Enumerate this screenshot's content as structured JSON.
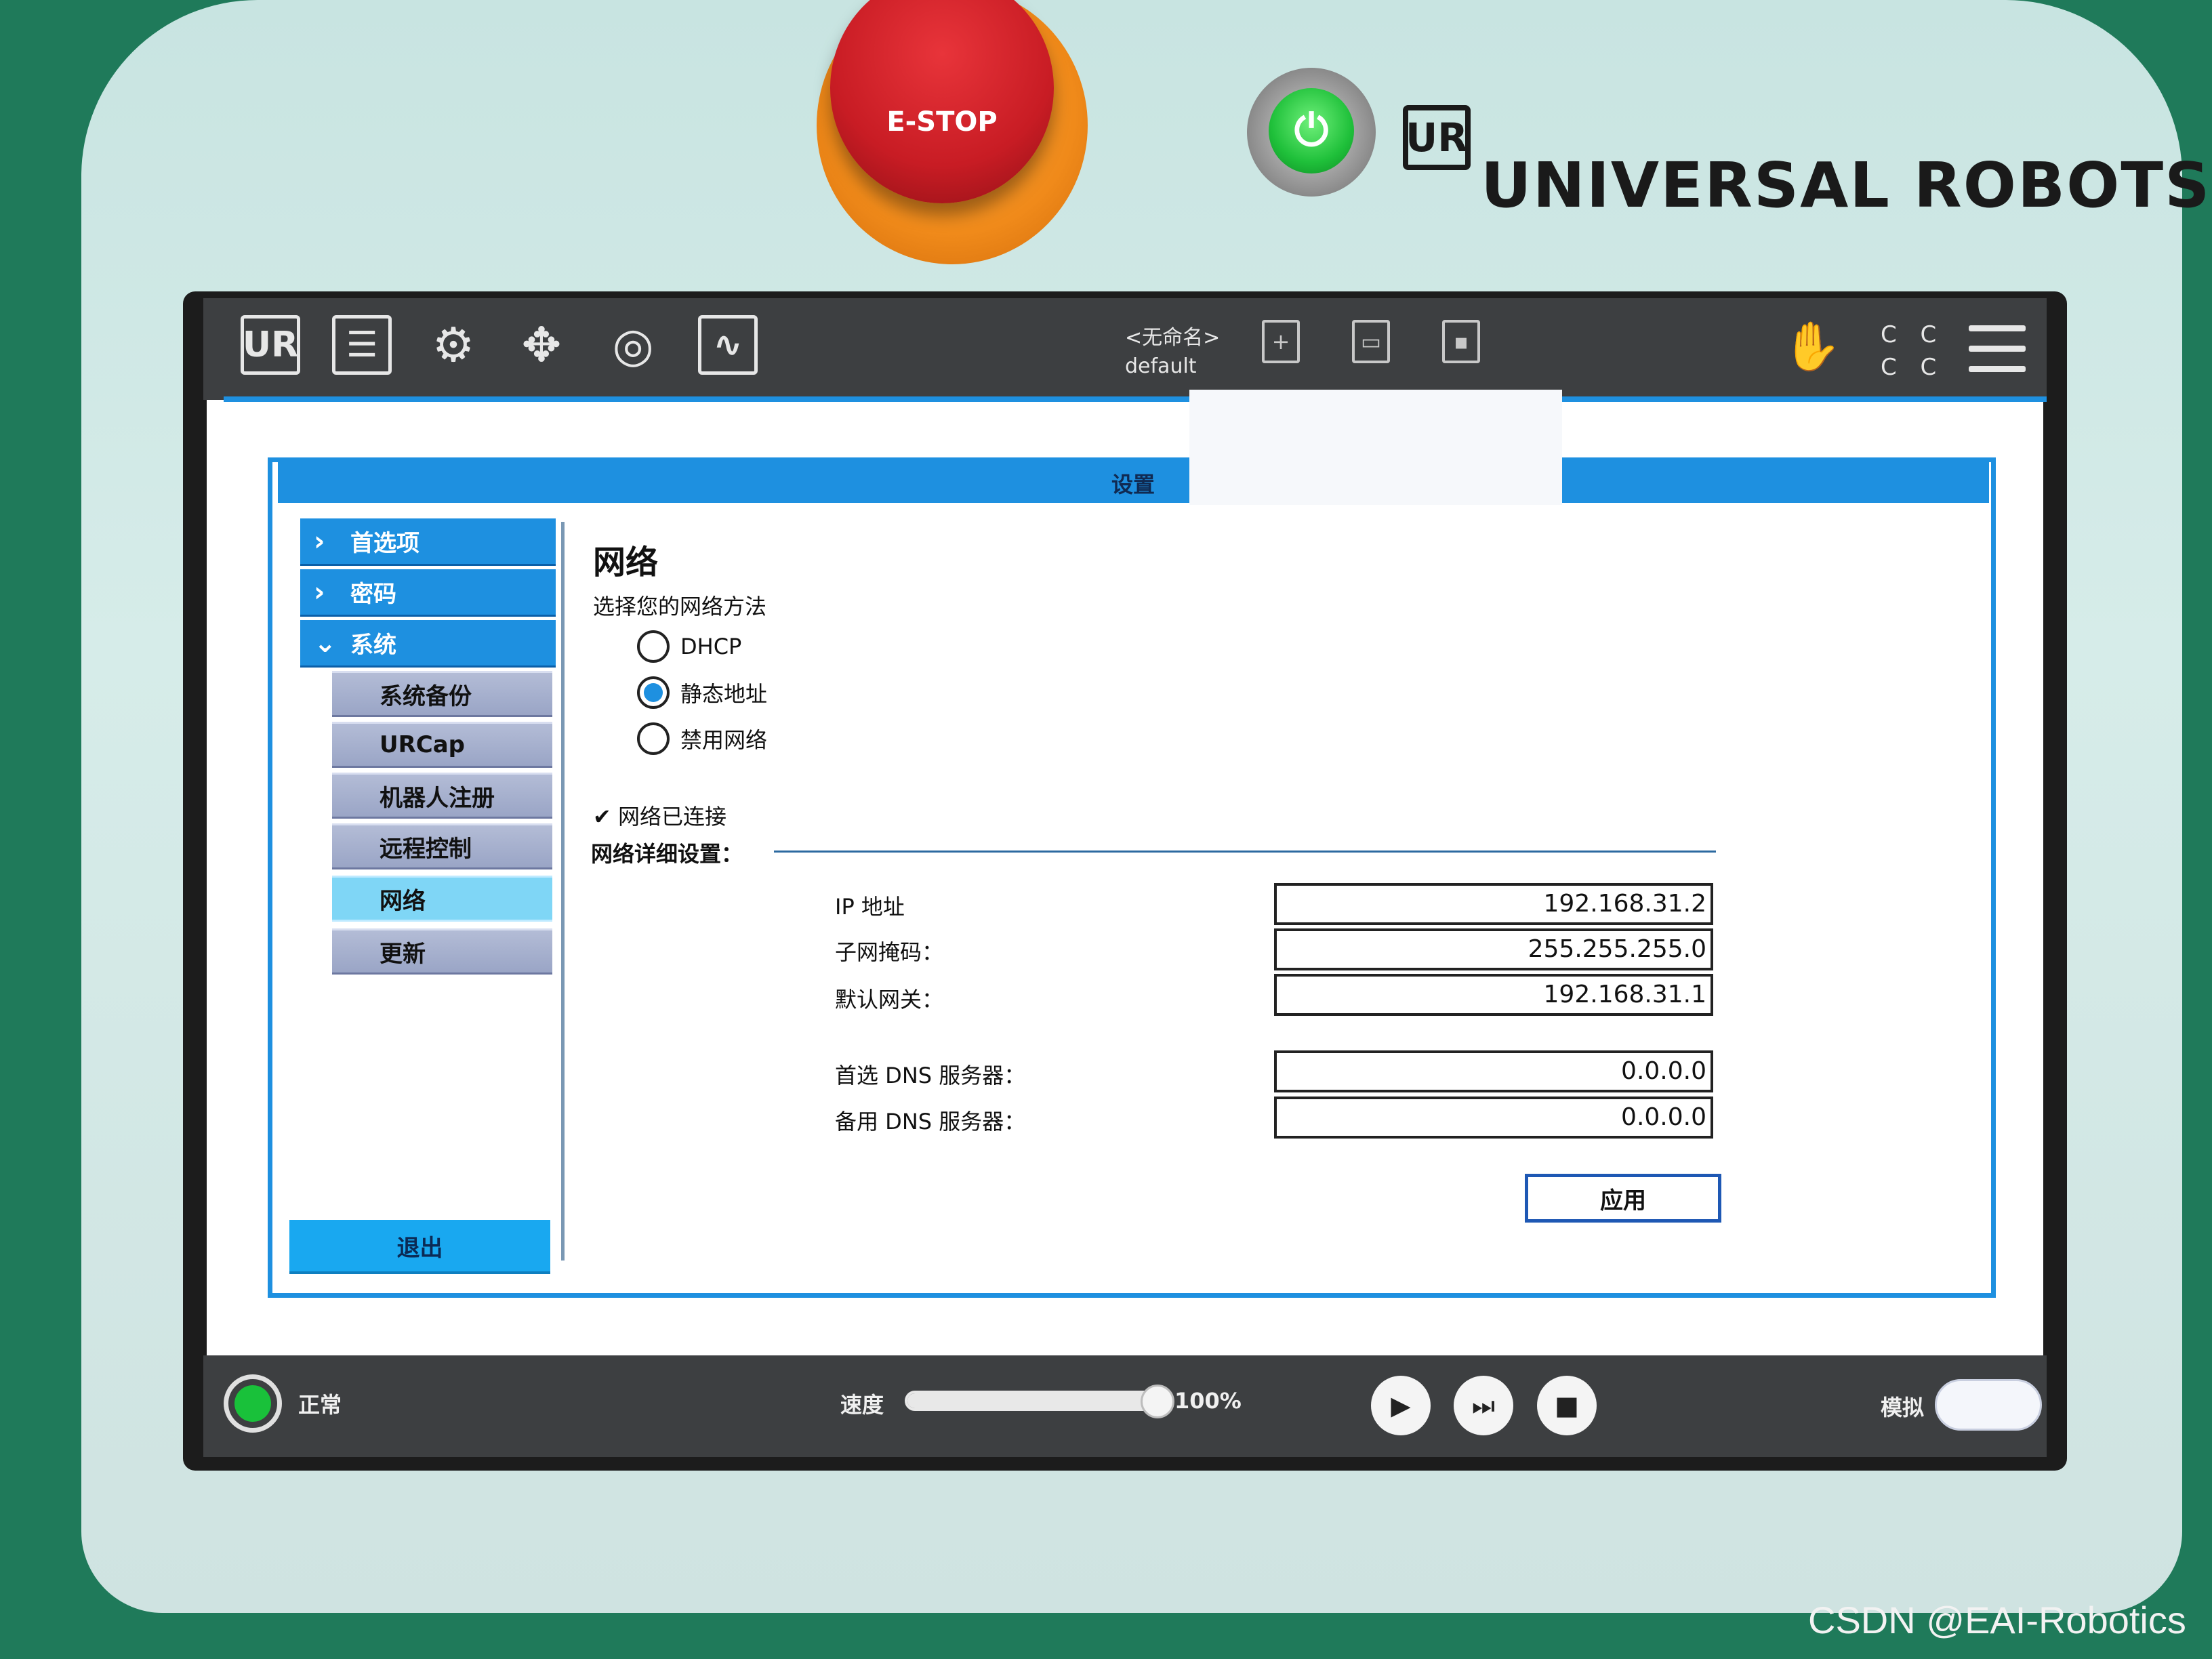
{
  "hardware": {
    "estop_label": "E-STOP",
    "power_symbol": "⏻",
    "logo_mark": "UR",
    "brand": "UNIVERSAL ROBOTS"
  },
  "topbar": {
    "icons": [
      "ur-logo-icon",
      "program-icon",
      "installation-icon",
      "move-icon",
      "io-icon",
      "log-icon"
    ],
    "program_name": "<无命名>",
    "installation_name": "default",
    "cc_text": "C C\nC C"
  },
  "dialog": {
    "title": "设置"
  },
  "sidebar": {
    "items": [
      {
        "label": "首选项",
        "chevron": "›"
      },
      {
        "label": "密码",
        "chevron": "›"
      },
      {
        "label": "系统",
        "chevron": "⌄"
      }
    ],
    "sub_items": [
      {
        "label": "系统备份"
      },
      {
        "label": "URCap"
      },
      {
        "label": "机器人注册"
      },
      {
        "label": "远程控制"
      },
      {
        "label": "网络"
      },
      {
        "label": "更新"
      }
    ],
    "active_sub": "网络",
    "exit_label": "退出"
  },
  "network": {
    "title": "网络",
    "method_prompt": "选择您的网络方法",
    "options": [
      {
        "label": "DHCP",
        "selected": false
      },
      {
        "label": "静态地址",
        "selected": true
      },
      {
        "label": "禁用网络",
        "selected": false
      }
    ],
    "connected_status": "✔ 网络已连接",
    "details_label": "网络详细设置：",
    "fields": [
      {
        "label": "IP 地址",
        "value": "192.168.31.2"
      },
      {
        "label": "子网掩码：",
        "value": "255.255.255.0"
      },
      {
        "label": "默认网关：",
        "value": "192.168.31.1"
      },
      {
        "label": "首选 DNS 服务器：",
        "value": "0.0.0.0"
      },
      {
        "label": "备用 DNS 服务器：",
        "value": "0.0.0.0"
      }
    ],
    "apply_label": "应用"
  },
  "footer": {
    "status": "正常",
    "speed_label": "速度",
    "speed_value": "100%",
    "speed_fraction": 1.0,
    "play_symbol": "▶",
    "step_symbol": "⏭",
    "stop_symbol": "■",
    "sim_label": "模拟"
  },
  "watermark": "CSDN @EAI-Robotics",
  "colors": {
    "accent": "#1e90e0",
    "active_nav": "#7fd6f6",
    "status_ok": "#19c13a",
    "estop": "#c81c24"
  }
}
